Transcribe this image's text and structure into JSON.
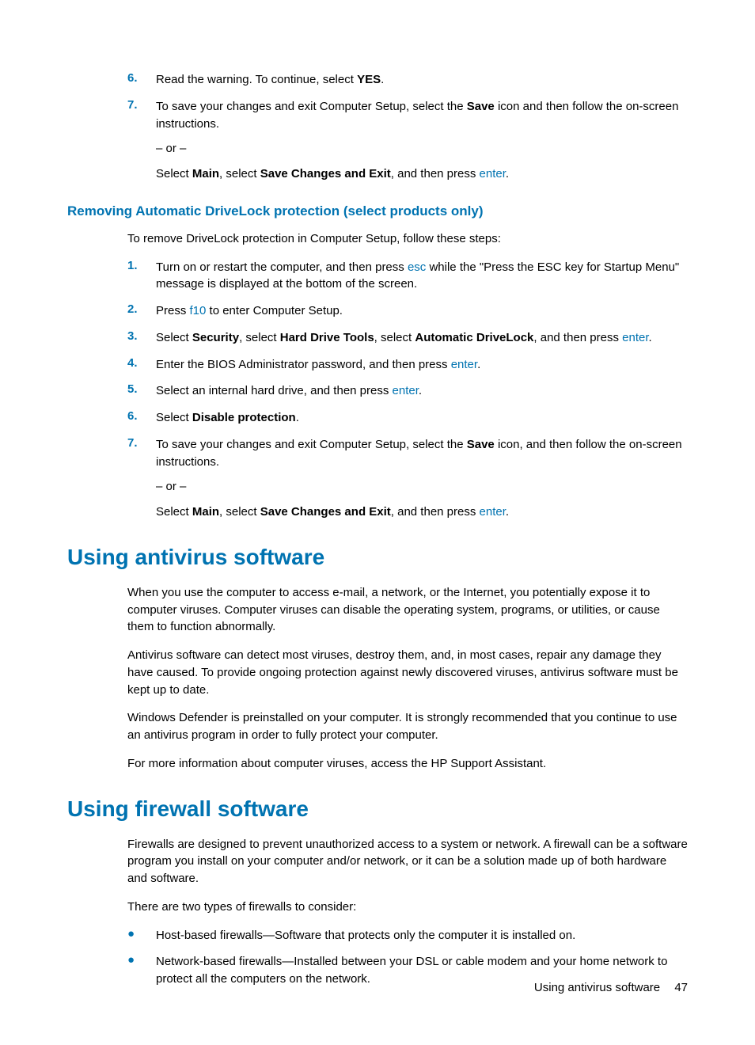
{
  "listA": {
    "item6": {
      "num": "6.",
      "text_a": "Read the warning. To continue, select ",
      "bold_a": "YES",
      "text_b": "."
    },
    "item7": {
      "num": "7.",
      "text_a": "To save your changes and exit Computer Setup, select the ",
      "bold_a": "Save",
      "text_b": " icon and then follow the on-screen instructions.",
      "or": "– or –",
      "p2_a": "Select ",
      "p2_bold1": "Main",
      "p2_b": ", select ",
      "p2_bold2": "Save Changes and Exit",
      "p2_c": ", and then press ",
      "p2_kb": "enter",
      "p2_d": "."
    }
  },
  "subheading1": "Removing Automatic DriveLock protection (select products only)",
  "intro1": "To remove DriveLock protection in Computer Setup, follow these steps:",
  "listB": {
    "item1": {
      "num": "1.",
      "a": "Turn on or restart the computer, and then press ",
      "kb": "esc",
      "b": " while the \"Press the ESC key for Startup Menu\" message is displayed at the bottom of the screen."
    },
    "item2": {
      "num": "2.",
      "a": "Press ",
      "kb": "f10",
      "b": " to enter Computer Setup."
    },
    "item3": {
      "num": "3.",
      "a": "Select ",
      "b1": "Security",
      "b": ", select ",
      "b2": "Hard Drive Tools",
      "c": ", select ",
      "b3": "Automatic DriveLock",
      "d": ", and then press ",
      "kb": "enter",
      "e": "."
    },
    "item4": {
      "num": "4.",
      "a": "Enter the BIOS Administrator password, and then press ",
      "kb": "enter",
      "b": "."
    },
    "item5": {
      "num": "5.",
      "a": "Select an internal hard drive, and then press ",
      "kb": "enter",
      "b": "."
    },
    "item6": {
      "num": "6.",
      "a": "Select ",
      "b1": "Disable protection",
      "b": "."
    },
    "item7": {
      "num": "7.",
      "a": "To save your changes and exit Computer Setup, select the ",
      "b1": "Save",
      "b": " icon, and then follow the on-screen instructions.",
      "or": "– or –",
      "p2_a": "Select ",
      "p2_b1": "Main",
      "p2_b": ", select ",
      "p2_b2": "Save Changes and Exit",
      "p2_c": ", and then press ",
      "p2_kb": "enter",
      "p2_d": "."
    }
  },
  "h1_av": "Using antivirus software",
  "av_p1": "When you use the computer to access e-mail, a network, or the Internet, you potentially expose it to computer viruses. Computer viruses can disable the operating system, programs, or utilities, or cause them to function abnormally.",
  "av_p2": "Antivirus software can detect most viruses, destroy them, and, in most cases, repair any damage they have caused. To provide ongoing protection against newly discovered viruses, antivirus software must be kept up to date.",
  "av_p3": "Windows Defender is preinstalled on your computer. It is strongly recommended that you continue to use an antivirus program in order to fully protect your computer.",
  "av_p4": "For more information about computer viruses, access the HP Support Assistant.",
  "h1_fw": "Using firewall software",
  "fw_p1": "Firewalls are designed to prevent unauthorized access to a system or network. A firewall can be a software program you install on your computer and/or network, or it can be a solution made up of both hardware and software.",
  "fw_p2": "There are two types of firewalls to consider:",
  "fw_ul": {
    "i1": "Host-based firewalls—Software that protects only the computer it is installed on.",
    "i2": "Network-based firewalls—Installed between your DSL or cable modem and your home network to protect all the computers on the network."
  },
  "footer": {
    "section": "Using antivirus software",
    "page": "47"
  }
}
